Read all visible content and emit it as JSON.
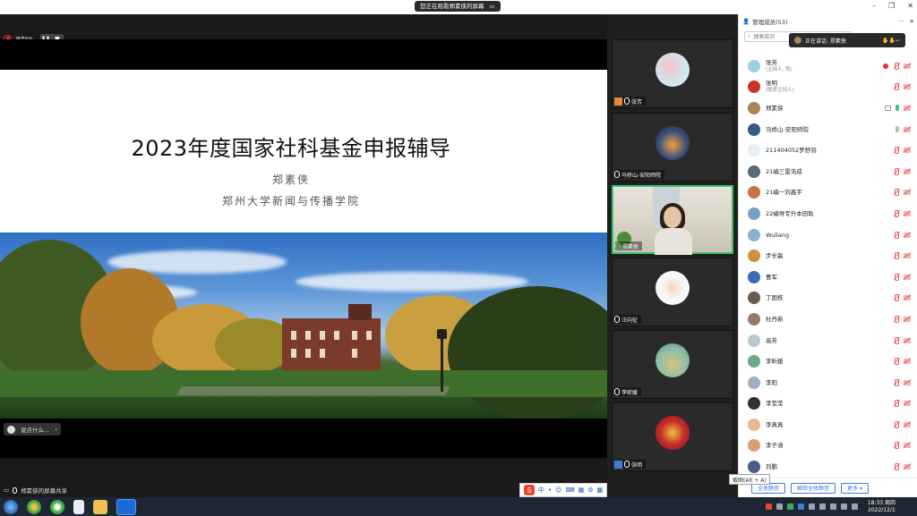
{
  "banner": {
    "share_notice": "您正在观看郑素侠的屏幕",
    "share_icon": "screen-share-icon"
  },
  "window_controls": {
    "minimize": "–",
    "restore": "❐",
    "close": "✕"
  },
  "recording": {
    "label": "录制中",
    "pause": "❚❚",
    "stop": "■"
  },
  "slide": {
    "title": "2023年度国家社科基金申报辅导",
    "author": "郑素侠",
    "school": "郑州大学新闻与传播学院"
  },
  "say_something": {
    "label": "说点什么...",
    "arrow": "‹"
  },
  "stage_footer": {
    "label": "郑素侠的屏幕共享"
  },
  "video_tiles": [
    {
      "name": "张芳",
      "color": "#e98b2a",
      "avatar": "#cfe8f0"
    },
    {
      "name": "马桥山-安阳师院",
      "color": "",
      "avatar": "#3a4f7a"
    },
    {
      "name": "郑素侠",
      "color": "",
      "avatar": ""
    },
    {
      "name": "汪向征",
      "color": "",
      "avatar": "#f4f4f4"
    },
    {
      "name": "李昕媛",
      "color": "",
      "avatar": "#8cc0a8"
    },
    {
      "name": "张明",
      "color": "#3d7cd8",
      "avatar": "#c82a2a"
    }
  ],
  "panel": {
    "title": "管理成员(53)",
    "more": "···",
    "search_placeholder": "搜索成员",
    "speaking": "正在讲话: 郑素侠"
  },
  "participants": [
    {
      "name": "张芳",
      "sub": "(主持人, 我)",
      "avatar": "#9ad0e0",
      "icons": [
        "rec",
        "mute",
        "cam"
      ]
    },
    {
      "name": "张明",
      "sub": "(联席主持人)",
      "avatar": "#c8342a",
      "icons": [
        "mute",
        "cam"
      ]
    },
    {
      "name": "郑素侠",
      "sub": "",
      "avatar": "#a8855a",
      "icons": [
        "screen",
        "mic-on",
        "cam"
      ]
    },
    {
      "name": "马桥山-安阳师院",
      "sub": "",
      "avatar": "#3a5a8a",
      "icons": [
        "mic-gray",
        "cam"
      ]
    },
    {
      "name": "211404052罗舒羽",
      "sub": "",
      "avatar": "#e6eef4",
      "icons": [
        "mute",
        "cam"
      ]
    },
    {
      "name": "21编三雷浩成",
      "sub": "",
      "avatar": "#556a7a",
      "icons": [
        "mute",
        "cam"
      ]
    },
    {
      "name": "21编一刘鑫宇",
      "sub": "",
      "avatar": "#c8704a",
      "icons": [
        "mute",
        "cam"
      ]
    },
    {
      "name": "22编导专升本田耿",
      "sub": "",
      "avatar": "#7aa0c8",
      "icons": [
        "mute",
        "cam"
      ]
    },
    {
      "name": "Wuliang",
      "sub": "",
      "avatar": "#8ab0d0",
      "icons": [
        "mute",
        "cam"
      ]
    },
    {
      "name": "步长磊",
      "sub": "",
      "avatar": "#d09040",
      "icons": [
        "mute",
        "cam"
      ]
    },
    {
      "name": "曹军",
      "sub": "",
      "avatar": "#3d6ab8",
      "icons": [
        "mute",
        "cam"
      ]
    },
    {
      "name": "丁国栋",
      "sub": "",
      "avatar": "#6a5a4a",
      "icons": [
        "mute",
        "cam"
      ]
    },
    {
      "name": "杜丹新",
      "sub": "",
      "avatar": "#9a7a6a",
      "icons": [
        "mute",
        "cam"
      ]
    },
    {
      "name": "高芳",
      "sub": "",
      "avatar": "#b8c8d0",
      "icons": [
        "mute",
        "cam"
      ]
    },
    {
      "name": "李昕媛",
      "sub": "",
      "avatar": "#6aa888",
      "icons": [
        "mute",
        "cam"
      ]
    },
    {
      "name": "李阳",
      "sub": "",
      "avatar": "#a0b0c0",
      "icons": [
        "mute",
        "cam"
      ]
    },
    {
      "name": "李莹莹",
      "sub": "",
      "avatar": "#303030",
      "icons": [
        "mute",
        "cam"
      ]
    },
    {
      "name": "李真真",
      "sub": "",
      "avatar": "#e8b890",
      "icons": [
        "mute",
        "cam"
      ]
    },
    {
      "name": "李子涵",
      "sub": "",
      "avatar": "#d8a070",
      "icons": [
        "mute",
        "cam"
      ]
    },
    {
      "name": "刘鹏",
      "sub": "",
      "avatar": "#4a5a8a",
      "icons": [
        "mute",
        "cam"
      ]
    }
  ],
  "footer_buttons": {
    "mute_all": "全体静音",
    "unmute_all": "解除全体静音",
    "more": "更多 ▾"
  },
  "tooltip": {
    "text": "截图(Alt + A)"
  },
  "ime": {
    "logo": "S",
    "lang": "中",
    "items": [
      "•",
      "☺",
      "⌨",
      "▦",
      "⚙",
      "▩"
    ]
  },
  "clock": {
    "time": "18:33 周四",
    "date": "2022/12/1"
  }
}
